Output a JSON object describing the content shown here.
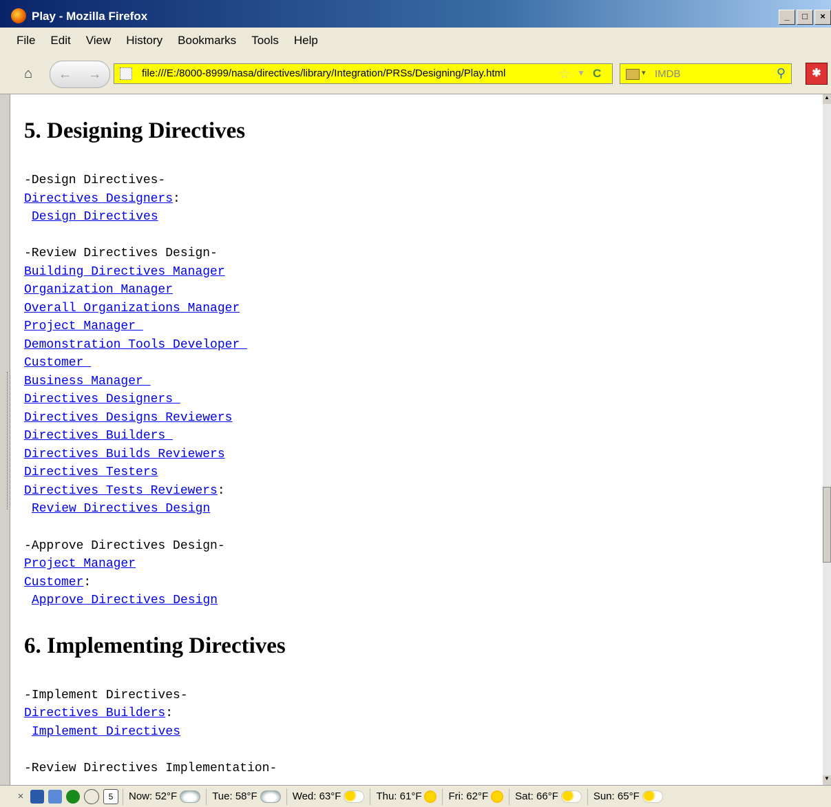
{
  "window": {
    "title": "Play - Mozilla Firefox",
    "controls": [
      "_",
      "□",
      "×"
    ]
  },
  "menu": [
    "File",
    "Edit",
    "View",
    "History",
    "Bookmarks",
    "Tools",
    "Help"
  ],
  "nav": {
    "url": "file:///E:/8000-8999/nasa/directives/library/Integration/PRSs/Designing/Play.html",
    "search_engine": "IMDB",
    "search_placeholder": "IMDB"
  },
  "content": {
    "section5": {
      "heading": "5. Designing Directives",
      "design": {
        "label": "-Design Directives-",
        "roles": [
          "Directives Designers"
        ],
        "action": "Design Directives"
      },
      "review": {
        "label": "-Review Directives Design-",
        "roles": [
          "Building Directives Manager",
          "Organization Manager",
          "Overall Organizations Manager",
          "Project Manager ",
          "Demonstration Tools Developer ",
          "Customer ",
          "Business Manager ",
          "Directives Designers ",
          "Directives Designs Reviewers",
          "Directives Builders ",
          "Directives Builds Reviewers",
          "Directives Testers",
          "Directives Tests Reviewers"
        ],
        "action": "Review Directives Design"
      },
      "approve": {
        "label": "-Approve Directives Design-",
        "roles": [
          "Project Manager",
          "Customer"
        ],
        "action": "Approve Directives Design"
      }
    },
    "section6": {
      "heading": "6. Implementing Directives",
      "implement": {
        "label": "-Implement Directives-",
        "roles": [
          "Directives Builders"
        ],
        "action": "Implement Directives"
      },
      "review_label": "-Review Directives Implementation-"
    }
  },
  "statusbar": {
    "date_badge": "5",
    "forecast": [
      {
        "label": "Now: 52°F",
        "icon": "cloud"
      },
      {
        "label": "Tue: 58°F",
        "icon": "cloud"
      },
      {
        "label": "Wed: 63°F",
        "icon": "suncloud"
      },
      {
        "label": "Thu: 61°F",
        "icon": "sun"
      },
      {
        "label": "Fri: 62°F",
        "icon": "sun"
      },
      {
        "label": "Sat: 66°F",
        "icon": "suncloud"
      },
      {
        "label": "Sun: 65°F",
        "icon": "suncloud"
      }
    ]
  }
}
